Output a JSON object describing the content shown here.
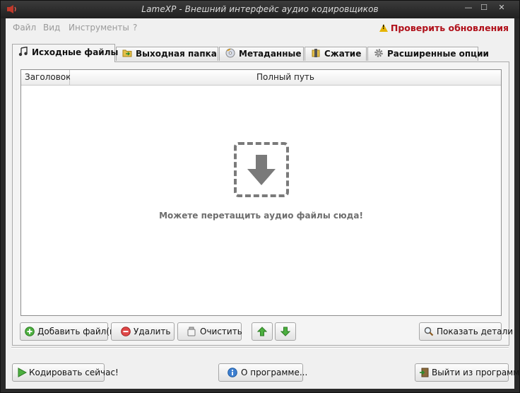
{
  "window": {
    "title": "LameXP - Внешний интерфейс аудио кодировщиков",
    "buttons": {
      "minimize": "—",
      "maximize": "☐",
      "close": "✕"
    }
  },
  "menubar": {
    "items": [
      "Файл",
      "Вид",
      "Инструменты",
      "?"
    ],
    "update_link": "Проверить обновления",
    "update_color": "#b0101a"
  },
  "tabs": [
    {
      "label": "Исходные файлы",
      "icon": "music-note-icon",
      "active": true
    },
    {
      "label": "Выходная папка",
      "icon": "folder-arrow-icon",
      "active": false
    },
    {
      "label": "Метаданные",
      "icon": "cd-disc-icon",
      "active": false
    },
    {
      "label": "Сжатие",
      "icon": "compress-icon",
      "active": false
    },
    {
      "label": "Расширенные опции",
      "icon": "gear-icon",
      "active": false
    }
  ],
  "file_list": {
    "columns": [
      "Заголовок",
      "Полный путь"
    ],
    "rows": [],
    "drop_hint": "Можете перетащить аудио файлы сюда!",
    "drop_icon": "download-arrow-icon"
  },
  "file_buttons": {
    "add": {
      "label": "Добавить файл(ы)",
      "icon": "add-green-icon"
    },
    "remove": {
      "label": "Удалить",
      "icon": "remove-red-icon"
    },
    "clear": {
      "label": "Очистить",
      "icon": "clear-icon"
    },
    "move_up": {
      "icon": "arrow-up-green-icon"
    },
    "move_down": {
      "icon": "arrow-down-green-icon"
    },
    "details": {
      "label": "Показать детали",
      "icon": "magnifier-icon"
    }
  },
  "footer_buttons": {
    "encode": {
      "label": "Кодировать сейчас!",
      "icon": "play-green-icon"
    },
    "about": {
      "label": "О программе...",
      "icon": "info-icon"
    },
    "exit": {
      "label": "Выйти из программы",
      "icon": "exit-icon"
    }
  }
}
